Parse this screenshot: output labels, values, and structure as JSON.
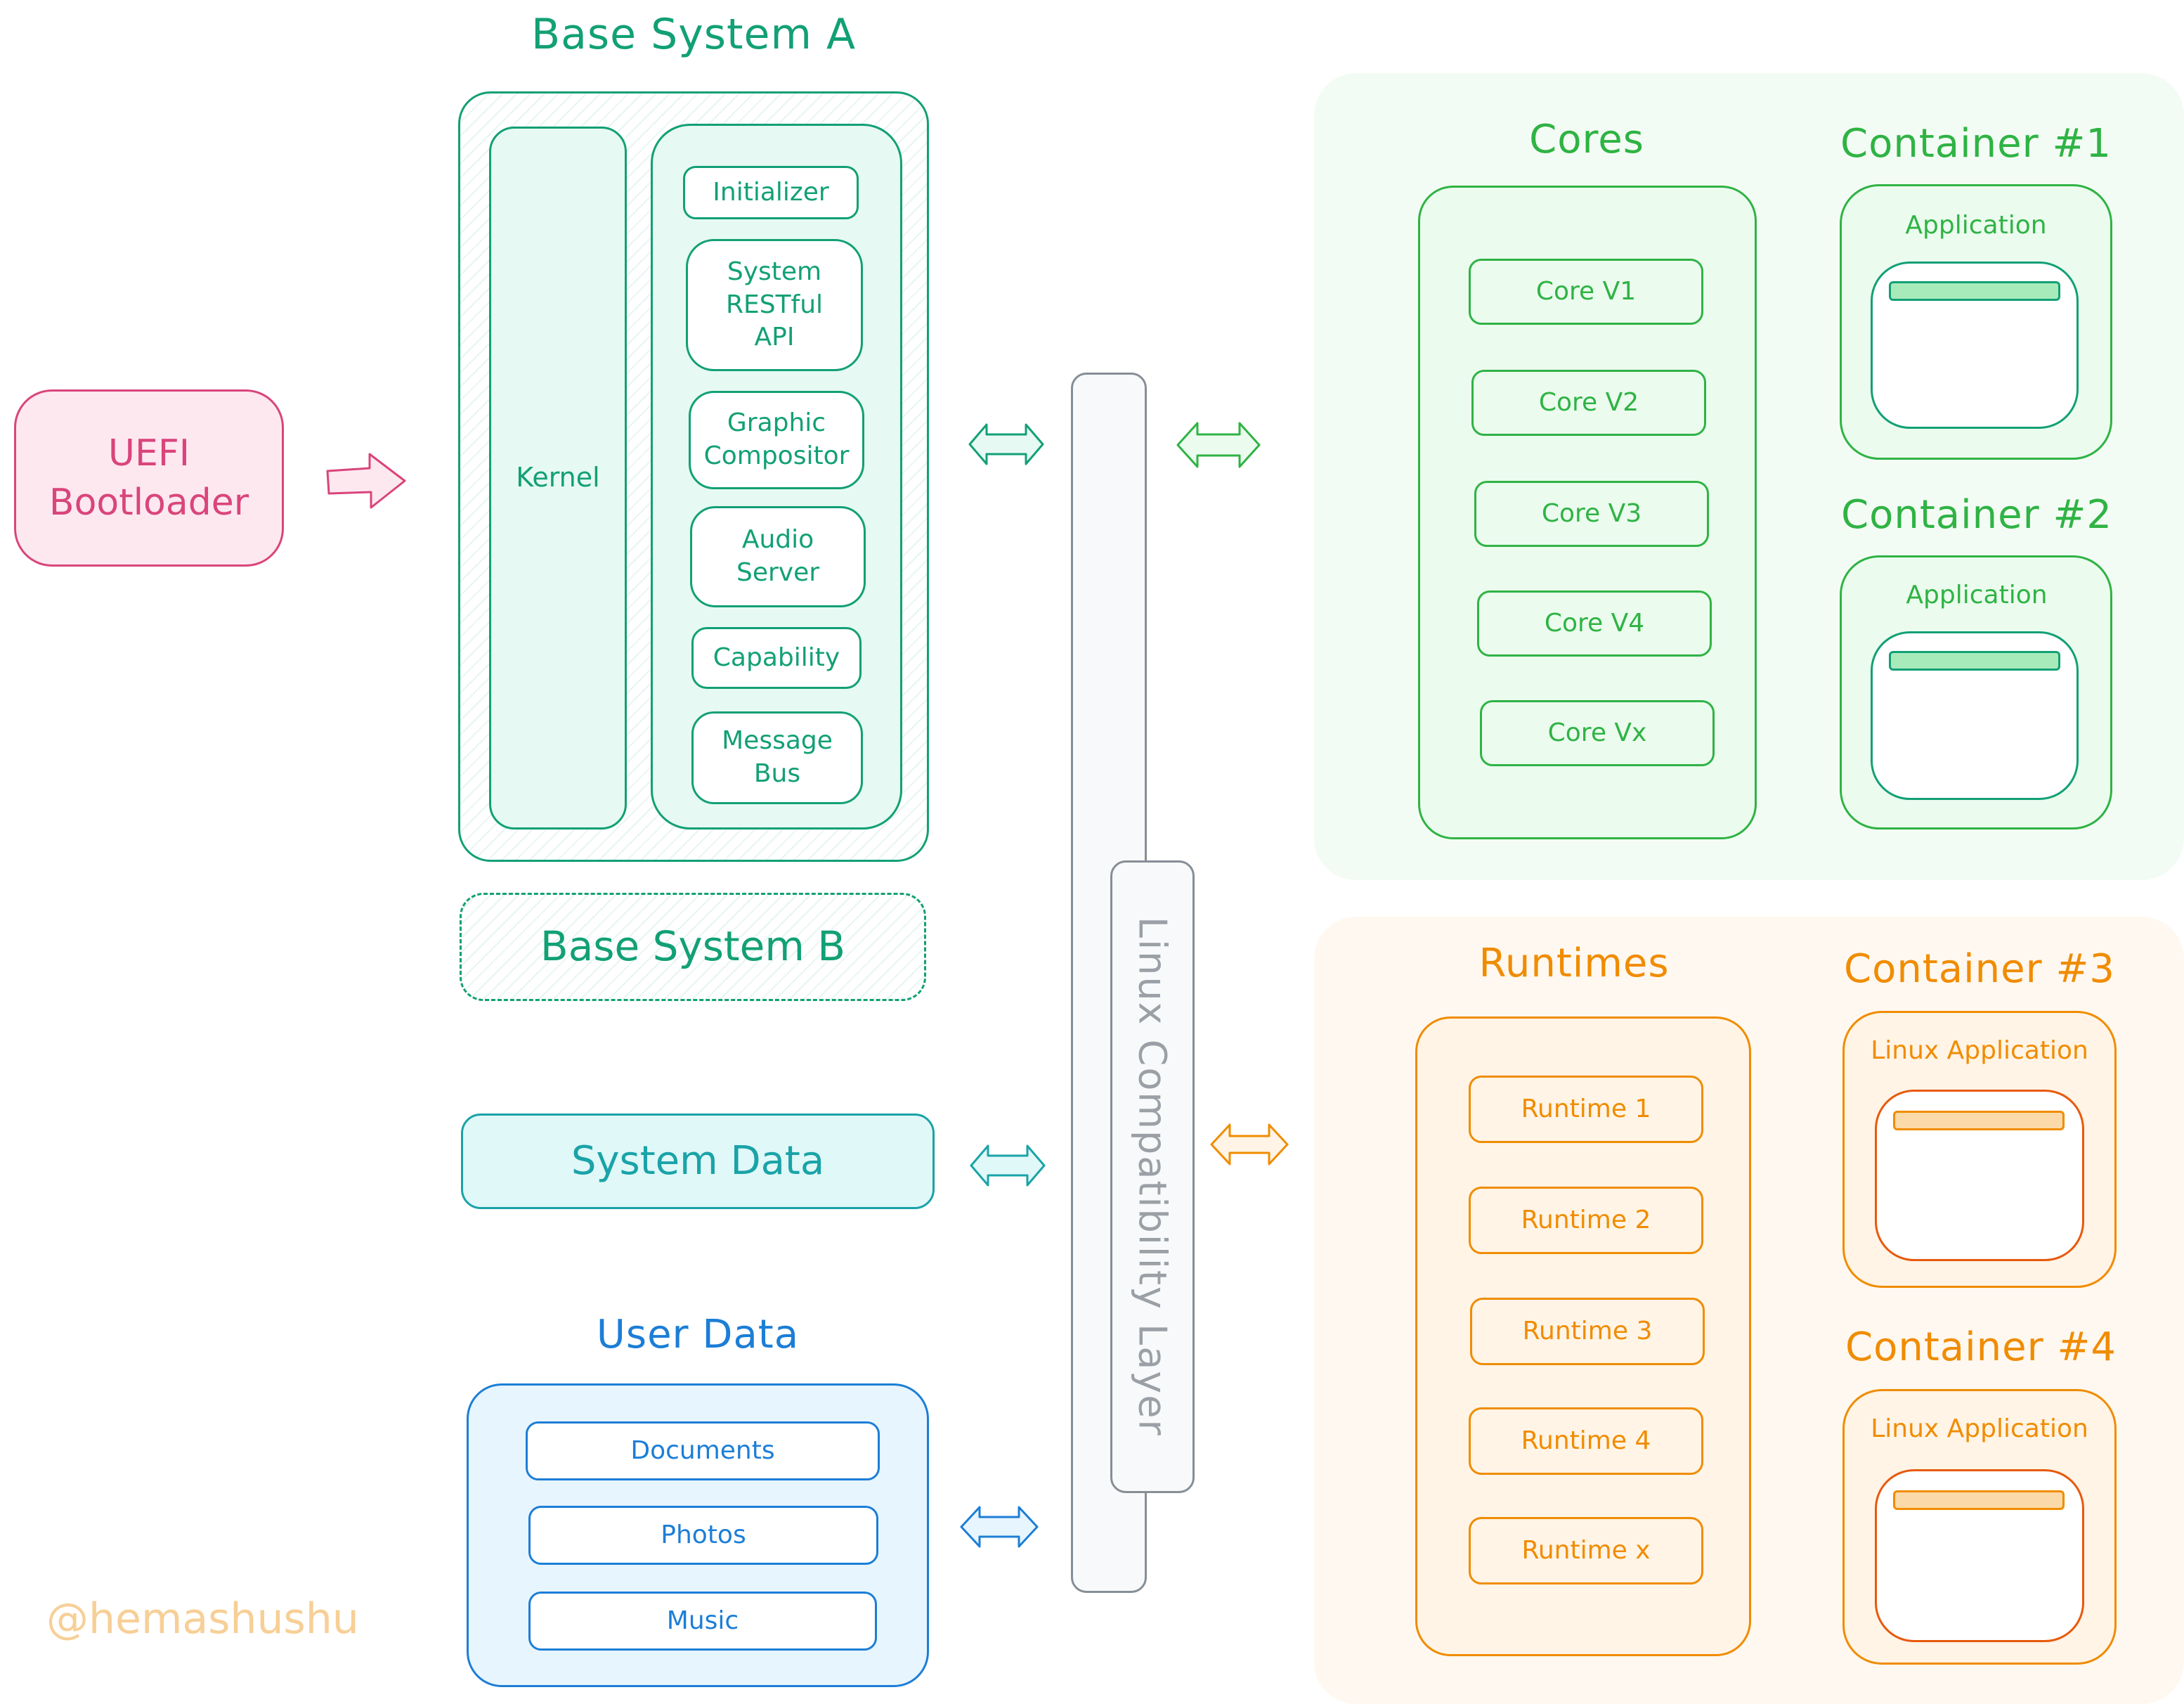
{
  "boot": {
    "label": "UEFI\nBootloader",
    "color": "#d9457b",
    "fill": "#fde8f0"
  },
  "base_system_a": {
    "title": "Base System A",
    "kernel_label": "Kernel",
    "services": [
      {
        "label": "Initializer"
      },
      {
        "label": "System\nRESTful\nAPI"
      },
      {
        "label": "Graphic\nCompositor"
      },
      {
        "label": "Audio\nServer"
      },
      {
        "label": "Capability"
      },
      {
        "label": "Message\nBus"
      }
    ],
    "color": "#12a075",
    "fill": "#e6f9f2"
  },
  "base_system_b": {
    "title": "Base System B",
    "style": "dashed"
  },
  "system_data": {
    "label": "System Data",
    "color": "#1aa3a8",
    "fill": "#e0f8f8"
  },
  "user_data": {
    "title": "User Data",
    "items": [
      {
        "label": "Documents"
      },
      {
        "label": "Photos"
      },
      {
        "label": "Music"
      }
    ],
    "color": "#1c7ed6",
    "fill": "#e7f5ff"
  },
  "compat_layer": {
    "label": "Linux Compatibility Layer",
    "color": "#868e96",
    "fill": "#f8f9fa"
  },
  "cores_section": {
    "cores_title": "Cores",
    "cores": [
      {
        "label": "Core V1"
      },
      {
        "label": "Core V2"
      },
      {
        "label": "Core V3"
      },
      {
        "label": "Core V4"
      },
      {
        "label": "Core Vx"
      }
    ],
    "containers": [
      {
        "title": "Container #1",
        "app_label": "Application"
      },
      {
        "title": "Container #2",
        "app_label": "Application"
      }
    ],
    "color": "#2fb344",
    "fill": "#ebfbee",
    "bg": "#f3fcf4"
  },
  "runtimes_section": {
    "runtimes_title": "Runtimes",
    "runtimes": [
      {
        "label": "Runtime 1"
      },
      {
        "label": "Runtime 2"
      },
      {
        "label": "Runtime 3"
      },
      {
        "label": "Runtime 4"
      },
      {
        "label": "Runtime x"
      }
    ],
    "containers": [
      {
        "title": "Container #3",
        "app_label": "Linux Application"
      },
      {
        "title": "Container #4",
        "app_label": "Linux Application"
      }
    ],
    "color": "#f08c00",
    "fill": "#fff4e6",
    "bg": "#fff8f0"
  },
  "arrows": [
    {
      "name": "boot-to-base-arrow",
      "type": "single",
      "color": "#d9457b"
    },
    {
      "name": "base-to-compat-arrow",
      "type": "double",
      "color": "#12a075"
    },
    {
      "name": "compat-to-cores-arrow",
      "type": "double",
      "color": "#2fb344"
    },
    {
      "name": "systemdata-to-compat-arrow",
      "type": "double",
      "color": "#1aa3a8"
    },
    {
      "name": "userdata-to-compat-arrow",
      "type": "double",
      "color": "#1c7ed6"
    },
    {
      "name": "compat-to-runtimes-arrow",
      "type": "double",
      "color": "#f08c00"
    }
  ],
  "watermark": "@hemashushu"
}
